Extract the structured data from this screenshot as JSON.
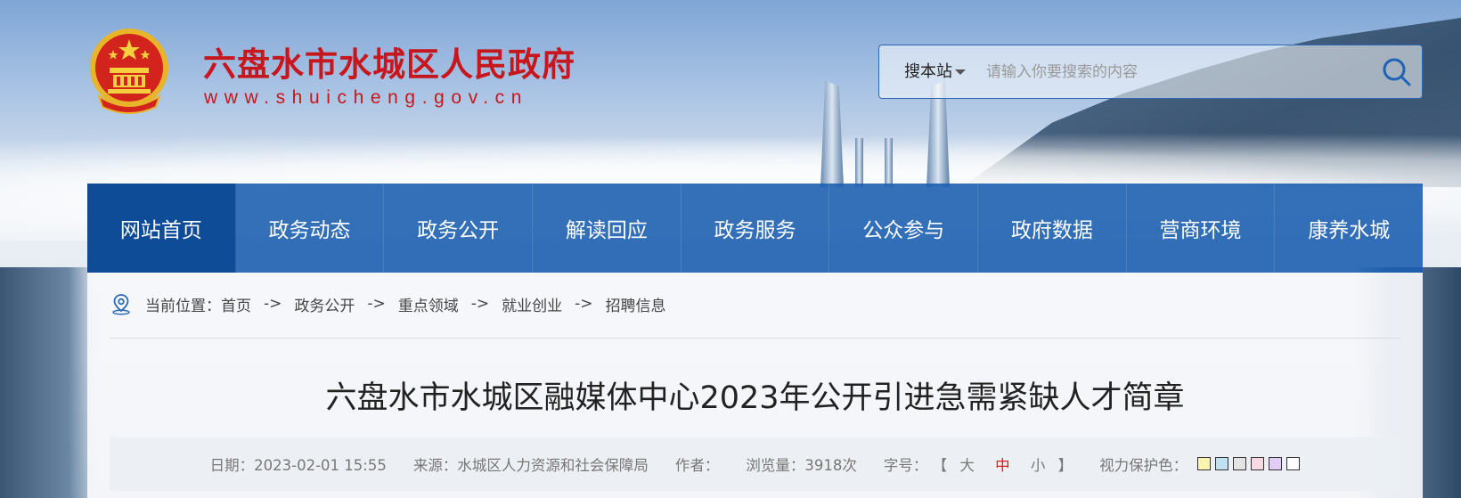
{
  "header": {
    "site_title": "六盘水市水城区人民政府",
    "site_domain": "www.shuicheng.gov.cn",
    "emblem_icon": "national-emblem-icon"
  },
  "search": {
    "scope_label": "搜本站",
    "placeholder": "请输入你要搜索的内容",
    "icon": "search-icon"
  },
  "nav": {
    "items": [
      {
        "label": "网站首页"
      },
      {
        "label": "政务动态"
      },
      {
        "label": "政务公开"
      },
      {
        "label": "解读回应"
      },
      {
        "label": "政务服务"
      },
      {
        "label": "公众参与"
      },
      {
        "label": "政府数据"
      },
      {
        "label": "营商环境"
      },
      {
        "label": "康养水城"
      }
    ]
  },
  "breadcrumb": {
    "prefix": "当前位置：",
    "separator": "->",
    "items": [
      "首页",
      "政务公开",
      "重点领域",
      "就业创业",
      "招聘信息"
    ]
  },
  "article": {
    "title": "六盘水市水城区融媒体中心2023年公开引进急需紧缺人才简章",
    "date": "日期：2023-02-01 15:55",
    "source": "来源：水城区人力资源和社会保障局",
    "author": "作者：",
    "views": "浏览量：3918次",
    "font_size_label": "字号：",
    "bracket_open": "【",
    "bracket_close": "】",
    "font_sizes": [
      "大",
      "中",
      "小"
    ],
    "eye_care_label": "视力保护色：",
    "eye_care_colors": [
      "#fcf4b3",
      "#bfe1f2",
      "#e3e3e3",
      "#f7d9e3",
      "#e1cdf7",
      "#ffffff"
    ]
  },
  "colors": {
    "brand_red": "#c8161d",
    "nav_blue": "#185cae",
    "active_font_size": "#e01a1a"
  }
}
